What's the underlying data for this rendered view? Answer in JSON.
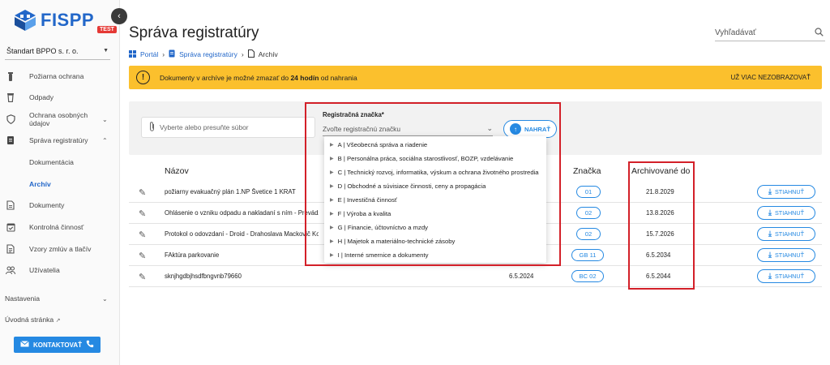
{
  "sidebar": {
    "logo_text": "FISPP",
    "logo_badge": "TEST",
    "org": "Štandart BPPO s. r. o.",
    "items": [
      {
        "label": "Požiarna ochrana"
      },
      {
        "label": "Odpady"
      },
      {
        "label": "Ochrana osobných údajov"
      },
      {
        "label": "Správa registratúry"
      },
      {
        "label": "Dokumentácia"
      },
      {
        "label": "Archív"
      },
      {
        "label": "Dokumenty"
      },
      {
        "label": "Kontrolná činnosť"
      },
      {
        "label": "Vzory zmlúv a tlačív"
      },
      {
        "label": "Užívatelia"
      },
      {
        "label": "Nastavenia"
      },
      {
        "label": "Úvodná stránka"
      }
    ],
    "contact_label": "KONTAKTOVAŤ"
  },
  "header": {
    "title": "Správa registratúry",
    "search_placeholder": "Vyhľadávať",
    "breadcrumb": [
      "Portál",
      "Správa registratúry",
      "Archív"
    ]
  },
  "banner": {
    "msg_before": "Dokumenty v archíve je možné zmazať do ",
    "msg_bold": "24 hodín",
    "msg_after": " od nahrania",
    "dismiss": "UŽ VIAC NEZOBRAZOVAŤ"
  },
  "upload": {
    "file_placeholder": "Vyberte alebo presuňte súbor",
    "reg_label": "Registračná značka*",
    "reg_placeholder": "Zvoľte registračnú značku",
    "button": "NAHRAŤ"
  },
  "dropdown": [
    "A | Všeobecná správa a riadenie",
    "B | Personálna práca, sociálna starostlivosť, BOZP, vzdelávanie",
    "C | Technický rozvoj, informatika, výskum a ochrana životného prostredia",
    "D | Obchodné a súvisiace činnosti, ceny a propagácia",
    "E | Investičná činnosť",
    "F | Výroba a kvalita",
    "G | Financie, účtovníctvo a mzdy",
    "H | Majetok a materiálno-technické zásoby",
    "I | Interné smernice a dokumenty"
  ],
  "table": {
    "headers": {
      "name": "Názov",
      "mark": "Značka",
      "archived": "Archivované do"
    },
    "download_label": "STIAHNUŤ",
    "rows": [
      {
        "name": "požiarny evakuačný plán 1.NP Švetice 1 KRAT",
        "created": "",
        "mark": "01",
        "archived": "21.8.2029"
      },
      {
        "name": "Ohlásenie o vzniku odpadu a nakladaní s ním - Prevádzka - D",
        "created": "",
        "mark": "02",
        "archived": "13.8.2026"
      },
      {
        "name": "Protokol o odovzdaní - Droid - Drahoslava Mackovič Kováčov",
        "created": "",
        "mark": "02",
        "archived": "15.7.2026"
      },
      {
        "name": "FAktúra parkovanie",
        "created": "",
        "mark": "GB 11",
        "archived": "6.5.2034"
      },
      {
        "name": "sknjhgdbjhsdfbngvnb79660",
        "created": "6.5.2024",
        "mark": "BC 02",
        "archived": "6.5.2044"
      }
    ]
  }
}
